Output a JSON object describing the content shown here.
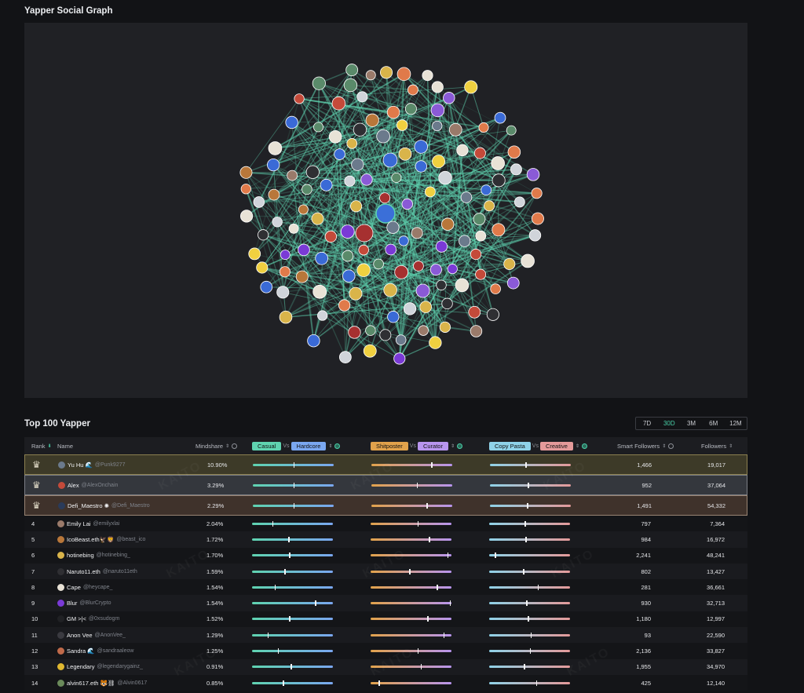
{
  "page": {
    "graph_title": "Yapper Social Graph",
    "table_title": "Top 100 Yapper",
    "watermark": "KAITO"
  },
  "periods": [
    {
      "label": "7D",
      "active": false
    },
    {
      "label": "30D",
      "active": true
    },
    {
      "label": "3M",
      "active": false
    },
    {
      "label": "6M",
      "active": false
    },
    {
      "label": "12M",
      "active": false
    }
  ],
  "headers": {
    "rank": "Rank",
    "name": "Name",
    "mindshare": "Mindshare",
    "casual": "Casual",
    "hardcore": "Hardcore",
    "shitposter": "Shitposter",
    "curator": "Curator",
    "copy_pasta": "Copy Pasta",
    "creative": "Creative",
    "vs": "Vs",
    "smart_followers": "Smart Followers",
    "followers": "Followers"
  },
  "colors": {
    "casual": "#5fd3b0",
    "hardcore": "#7aa7f0",
    "shitposter": "#e1a24b",
    "curator": "#b895ee",
    "copy_pasta": "#8fd2e8",
    "creative": "#e49a9a",
    "accent": "#49d0a8"
  },
  "rows": [
    {
      "rank": "1",
      "tier": "g",
      "name": "Yu Hu 🌊",
      "handle": "@Punk9277",
      "mindshare": "10.90%",
      "b1": 0.5,
      "b2": 0.74,
      "b3": 0.44,
      "smart": "1,466",
      "followers": "19,017",
      "avatar": "#6b7a8c"
    },
    {
      "rank": "2",
      "tier": "s",
      "name": "Alex",
      "handle": "@AlexOnchain",
      "mindshare": "3.29%",
      "b1": 0.5,
      "b2": 0.56,
      "b3": 0.47,
      "smart": "952",
      "followers": "37,064",
      "avatar": "#c44a3a"
    },
    {
      "rank": "3",
      "tier": "b",
      "name": "Defi_Maestro ✺",
      "handle": "@Defi_Maestro",
      "mindshare": "2.29%",
      "b1": 0.5,
      "b2": 0.68,
      "b3": 0.46,
      "smart": "1,491",
      "followers": "54,332",
      "avatar": "#2a3b5a"
    },
    {
      "rank": "4",
      "tier": "n",
      "name": "Emily Lai",
      "handle": "@emilyxlai",
      "mindshare": "2.04%",
      "b1": 0.25,
      "b2": 0.58,
      "b3": 0.44,
      "smart": "797",
      "followers": "7,364",
      "avatar": "#9a7a6a"
    },
    {
      "rank": "5",
      "tier": "n",
      "name": "IcoBeast.eth🦅🦁",
      "handle": "@beast_ico",
      "mindshare": "1.72%",
      "b1": 0.45,
      "b2": 0.72,
      "b3": 0.45,
      "smart": "984",
      "followers": "16,972",
      "avatar": "#b8773a"
    },
    {
      "rank": "6",
      "tier": "n",
      "name": "hotinebing",
      "handle": "@hotinebing_",
      "mindshare": "1.70%",
      "b1": 0.46,
      "b2": 0.95,
      "b3": 0.07,
      "smart": "2,241",
      "followers": "48,241",
      "avatar": "#d9b44a"
    },
    {
      "rank": "7",
      "tier": "n",
      "name": "Naruto11.eth",
      "handle": "@naruto11eth",
      "mindshare": "1.59%",
      "b1": 0.4,
      "b2": 0.48,
      "b3": 0.42,
      "smart": "802",
      "followers": "13,427",
      "avatar": "#2f2f33"
    },
    {
      "rank": "8",
      "tier": "n",
      "name": "Cape",
      "handle": "@heycape_",
      "mindshare": "1.54%",
      "b1": 0.28,
      "b2": 0.82,
      "b3": 0.6,
      "smart": "281",
      "followers": "36,661",
      "avatar": "#e8e2d6"
    },
    {
      "rank": "9",
      "tier": "n",
      "name": "Blur",
      "handle": "@BlurCrypto",
      "mindshare": "1.54%",
      "b1": 0.78,
      "b2": 0.98,
      "b3": 0.46,
      "smart": "930",
      "followers": "32,713",
      "avatar": "#7a3ad6"
    },
    {
      "rank": "10",
      "tier": "n",
      "name": "GM >|<",
      "handle": "@0xsudogm",
      "mindshare": "1.52%",
      "b1": 0.46,
      "b2": 0.7,
      "b3": 0.48,
      "smart": "1,180",
      "followers": "12,997",
      "avatar": "#202124"
    },
    {
      "rank": "11",
      "tier": "n",
      "name": "Anon Vee",
      "handle": "@AnonVee_",
      "mindshare": "1.29%",
      "b1": 0.19,
      "b2": 0.9,
      "b3": 0.51,
      "smart": "93",
      "followers": "22,590",
      "avatar": "#3a3a40"
    },
    {
      "rank": "12",
      "tier": "n",
      "name": "Sandra 🌊",
      "handle": "@sandraaleow",
      "mindshare": "1.25%",
      "b1": 0.32,
      "b2": 0.58,
      "b3": 0.5,
      "smart": "2,136",
      "followers": "33,827",
      "avatar": "#c06a4a"
    },
    {
      "rank": "13",
      "tier": "n",
      "name": "Legendary",
      "handle": "@legendarygainz_",
      "mindshare": "0.91%",
      "b1": 0.48,
      "b2": 0.62,
      "b3": 0.43,
      "smart": "1,955",
      "followers": "34,970",
      "avatar": "#e0b830"
    },
    {
      "rank": "14",
      "tier": "n",
      "name": "alvin617.eth 🐯⛓",
      "handle": "@Alvin0617",
      "mindshare": "0.85%",
      "b1": 0.38,
      "b2": 0.1,
      "b3": 0.58,
      "smart": "425",
      "followers": "12,140",
      "avatar": "#6a8a5a"
    }
  ]
}
